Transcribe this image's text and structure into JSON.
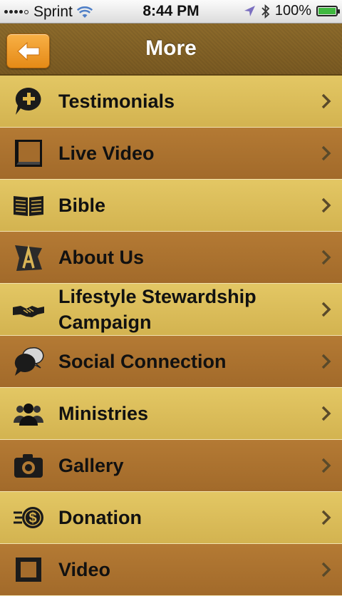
{
  "status_bar": {
    "carrier": "Sprint",
    "time": "8:44 PM",
    "battery": "100%",
    "battery_level": 1.0,
    "icons": [
      "signal-dots-icon",
      "wifi-icon",
      "location-arrow-icon",
      "bluetooth-icon",
      "battery-icon"
    ]
  },
  "nav": {
    "title": "More",
    "back_icon": "back-arrow-icon",
    "accent_color": "#f2a032"
  },
  "menu": {
    "items": [
      {
        "label": "Testimonials",
        "icon": "speech-plus-icon"
      },
      {
        "label": "Live Video",
        "icon": "video-screen-icon"
      },
      {
        "label": "Bible",
        "icon": "open-book-icon"
      },
      {
        "label": "About Us",
        "icon": "about-letter-icon"
      },
      {
        "label": "Lifestyle Stewardship Campaign",
        "icon": "handshake-icon"
      },
      {
        "label": "Social Connection",
        "icon": "speech-bubbles-icon"
      },
      {
        "label": "Ministries",
        "icon": "people-group-icon"
      },
      {
        "label": "Gallery",
        "icon": "camera-icon"
      },
      {
        "label": "Donation",
        "icon": "dollar-coin-icon"
      },
      {
        "label": "Video",
        "icon": "film-icon"
      }
    ]
  },
  "colors": {
    "row_light": "#dcc05c",
    "row_dark": "#ab7230",
    "navbar": "#84632a"
  }
}
